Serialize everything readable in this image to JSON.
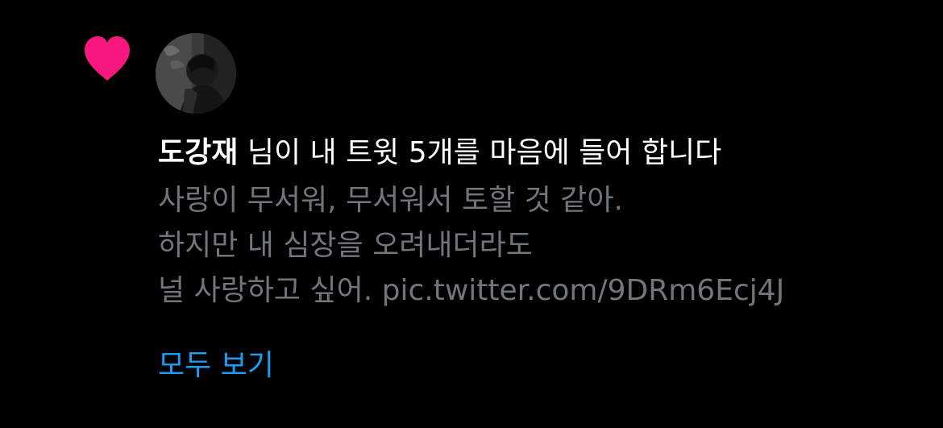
{
  "notification": {
    "icon": "heart-icon",
    "icon_color": "#f91880",
    "avatar": "user-avatar",
    "user_name": "도강재",
    "action_text": " 님이 내 트윗 5개를 마음에 들어 합니다",
    "tweet_lines": [
      "사랑이 무서워, 무서워서 토할 것 같아.",
      "하지만 내 심장을 오려내더라도",
      "널 사랑하고 싶어. pic.twitter.com/9DRm6Ecj4J"
    ],
    "show_all_label": "모두 보기"
  },
  "colors": {
    "background": "#000000",
    "primary_text": "#ffffff",
    "secondary_text": "#71767b",
    "link": "#1d9bf0",
    "like": "#f91880"
  }
}
